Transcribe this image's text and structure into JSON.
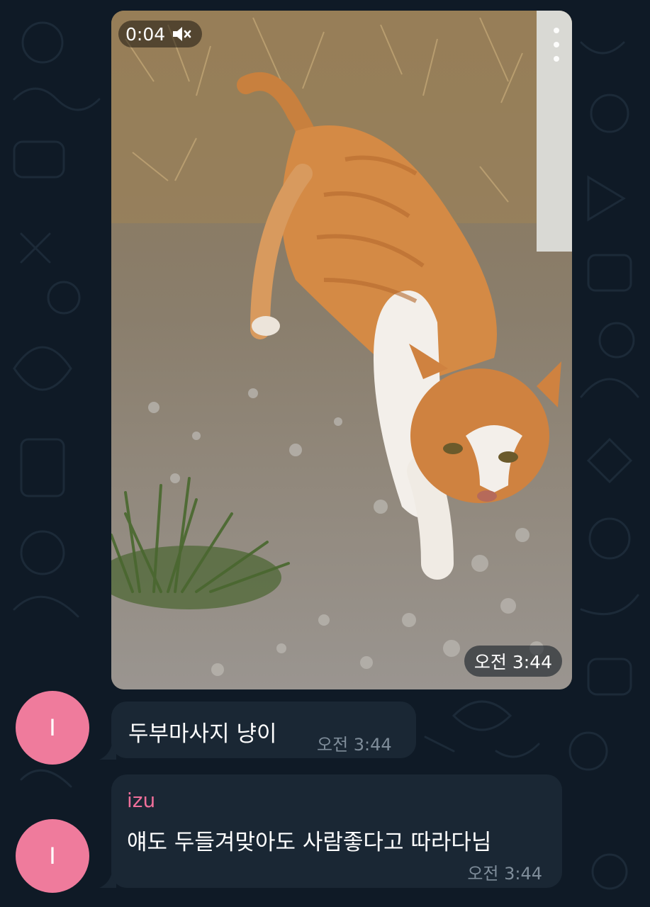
{
  "video": {
    "duration": "0:04",
    "mute_icon": "speaker-muted-icon",
    "time": "오전 3:44"
  },
  "messages": [
    {
      "avatar_initial": "I",
      "text": "두부마사지 냥이",
      "time": "오전 3:44"
    },
    {
      "avatar_initial": "I",
      "sender": "izu",
      "text": "얘도 두들겨맞아도 사람좋다고 따라다님",
      "time": "오전 3:44"
    }
  ],
  "colors": {
    "background": "#0f1a26",
    "bubble": "#1a2734",
    "avatar": "#ef7b9c",
    "sender_name": "#ef6f9a",
    "time_text": "#7f8d9a"
  }
}
